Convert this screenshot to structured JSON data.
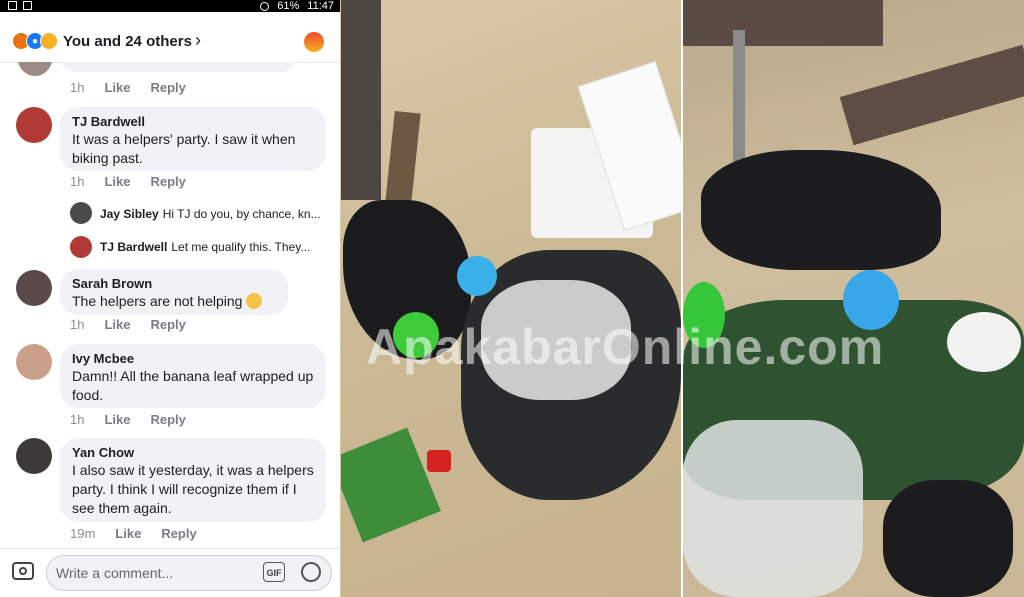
{
  "status_bar": {
    "battery": "61%",
    "time": "11:47"
  },
  "reaction_bar": {
    "summary": "You and 24 others"
  },
  "comments": [
    {
      "time": "1h",
      "like": "Like",
      "reply": "Reply"
    },
    {
      "name": "TJ Bardwell",
      "text": "It was a helpers' party. I saw it when biking past.",
      "time": "1h",
      "like": "Like",
      "reply": "Reply",
      "replies": [
        {
          "name": "Jay Sibley",
          "text": "Hi TJ do you, by chance, kn..."
        },
        {
          "name": "TJ Bardwell",
          "text": "Let me qualify this. They..."
        }
      ]
    },
    {
      "name": "Sarah Brown",
      "text": "The helpers are not helping",
      "time": "1h",
      "like": "Like",
      "reply": "Reply"
    },
    {
      "name": "Ivy Mcbee",
      "text": "Damn!! All  the banana leaf wrapped up food.",
      "time": "1h",
      "like": "Like",
      "reply": "Reply"
    },
    {
      "name": "Yan Chow",
      "text": "I also saw it yesterday, it was a helpers party. I think I will recognize them if I see them again.",
      "time": "19m",
      "like": "Like",
      "reply": "Reply"
    }
  ],
  "composer": {
    "placeholder": "Write a comment...",
    "gif_label": "GIF"
  },
  "watermark": "ApakabarOnline.com",
  "colors": {
    "fb_blue": "#1877f2",
    "bubble": "#f0f2f5",
    "meta_gray": "#8a8d91"
  }
}
